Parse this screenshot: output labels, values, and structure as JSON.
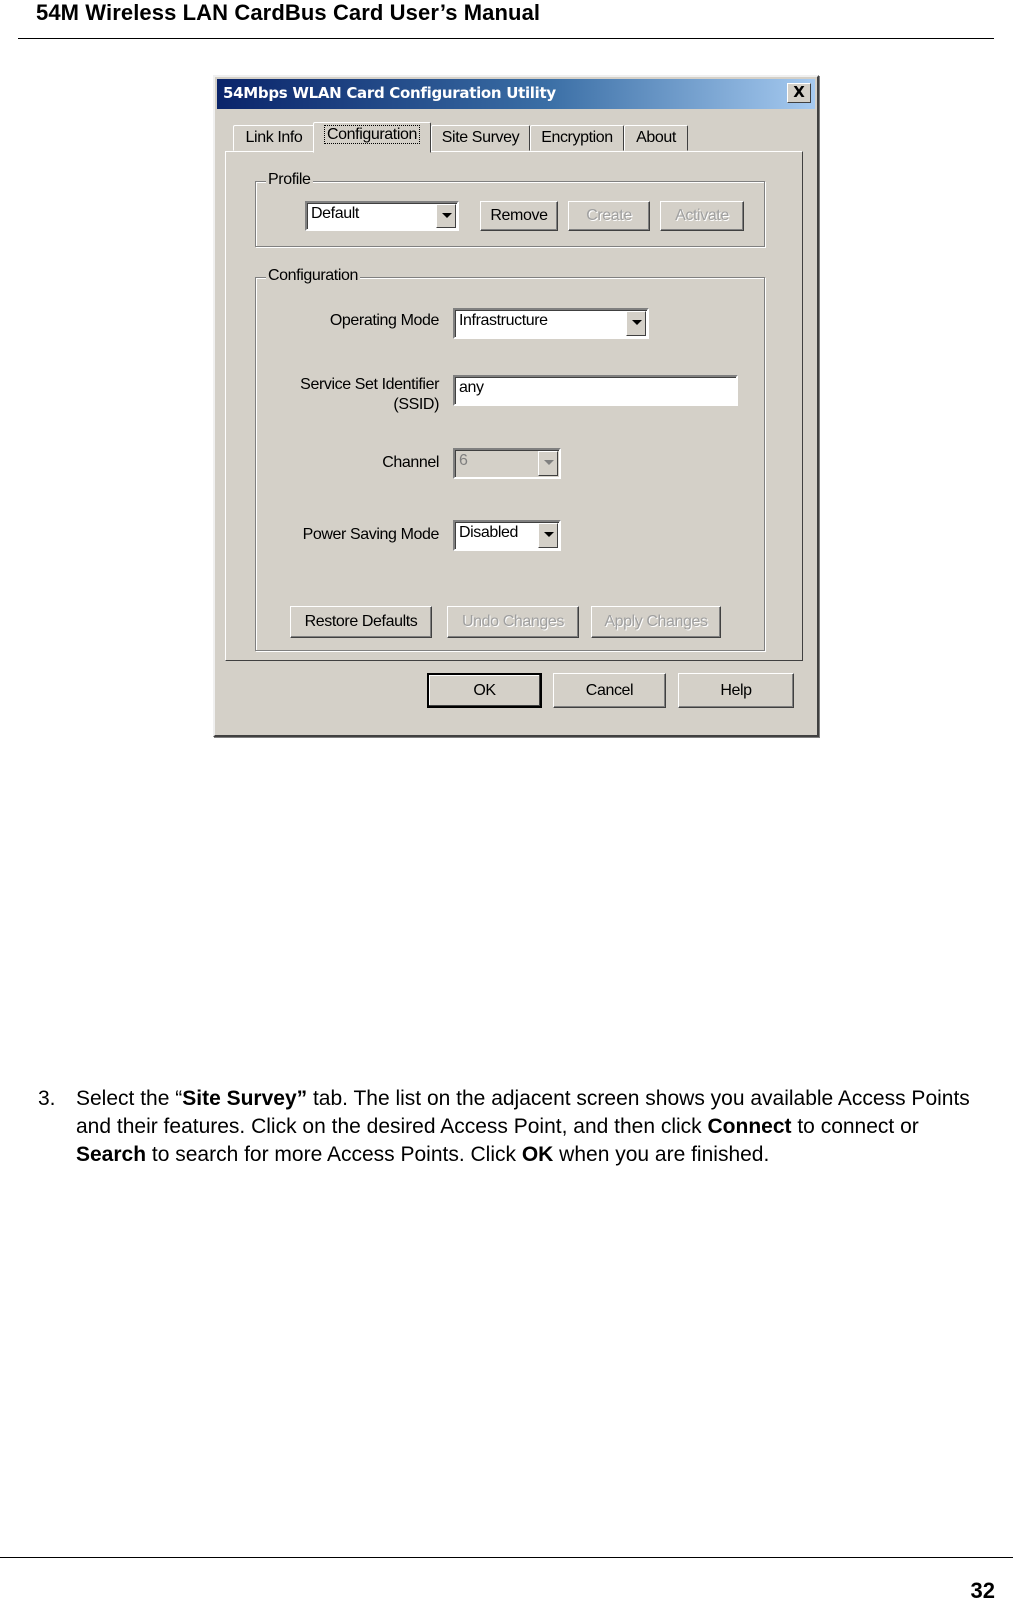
{
  "document": {
    "header_title": "54M Wireless LAN CardBus Card User’s Manual",
    "page_number": "32"
  },
  "dialog": {
    "title": "54Mbps WLAN Card Configuration Utility",
    "close_label": "X",
    "tabs": [
      {
        "label": "Link Info",
        "active": false
      },
      {
        "label": "Configuration",
        "active": true
      },
      {
        "label": "Site Survey",
        "active": false
      },
      {
        "label": "Encryption",
        "active": false
      },
      {
        "label": "About",
        "active": false
      }
    ],
    "profile": {
      "group_label": "Profile",
      "selected": "Default",
      "buttons": {
        "remove": "Remove",
        "create": "Create",
        "activate": "Activate"
      }
    },
    "configuration": {
      "group_label": "Configuration",
      "operating_mode": {
        "label": "Operating Mode",
        "value": "Infrastructure"
      },
      "ssid": {
        "label_line1": "Service Set Identifier",
        "label_line2": "(SSID)",
        "value": "any"
      },
      "channel": {
        "label": "Channel",
        "value": "6",
        "enabled": false
      },
      "power_saving": {
        "label": "Power Saving Mode",
        "value": "Disabled"
      },
      "buttons": {
        "restore_defaults": "Restore Defaults",
        "undo_changes": "Undo Changes",
        "apply_changes": "Apply Changes"
      }
    },
    "footer_buttons": {
      "ok": "OK",
      "cancel": "Cancel",
      "help": "Help"
    }
  },
  "instruction": {
    "number": "3.",
    "t1": "Select the “",
    "b1": "Site Survey”",
    "t2": " tab. The list on the adjacent screen shows you available Access Points and their features. Click on the desired Access Point, and then click ",
    "b2": "Connect",
    "t3": " to connect or ",
    "b3": "Search",
    "t4": " to search for more Access Points. Click ",
    "b4": "OK",
    "t5": " when you are finished."
  }
}
